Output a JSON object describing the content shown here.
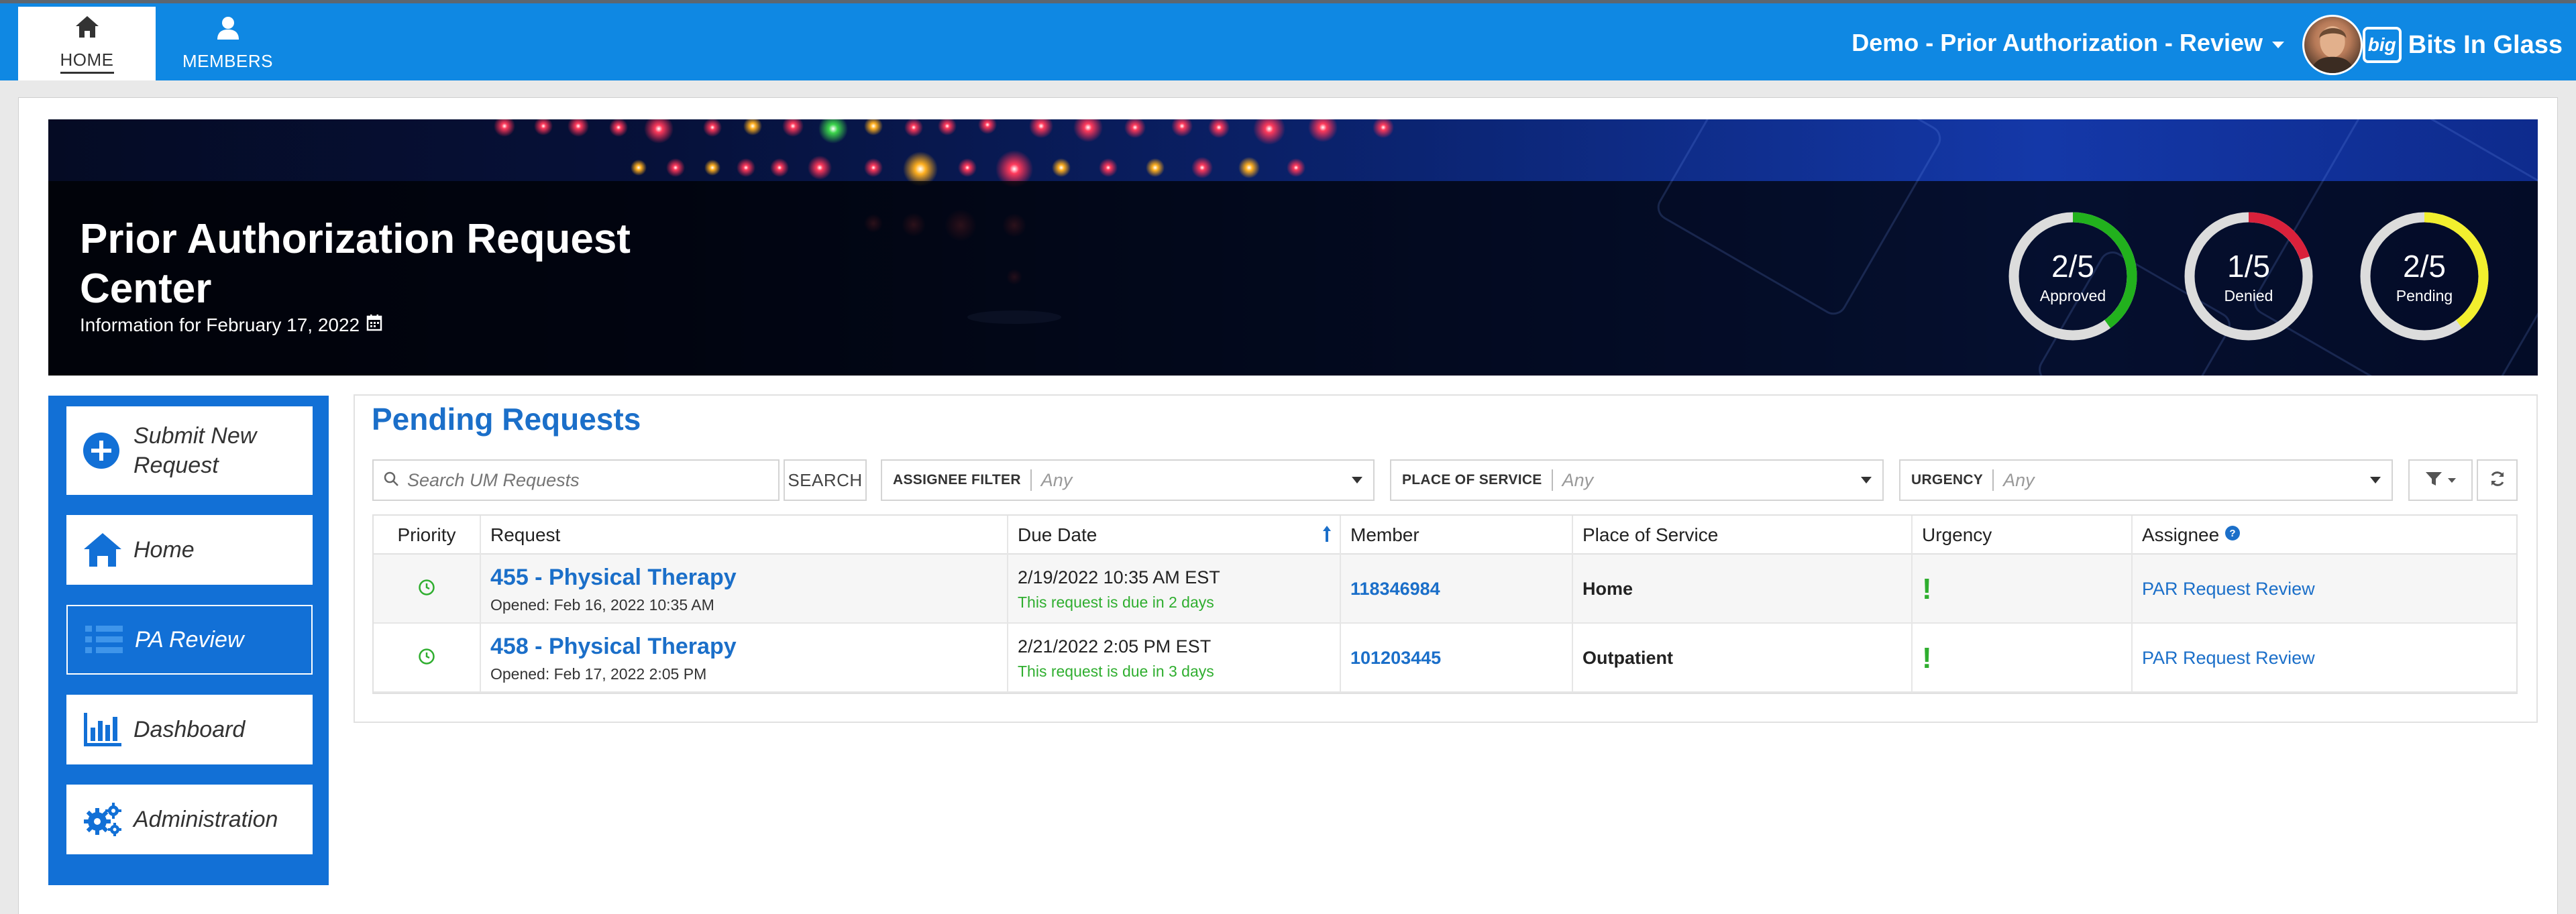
{
  "nav": {
    "tabs": [
      {
        "label": "HOME",
        "icon": "home-icon"
      },
      {
        "label": "MEMBERS",
        "icon": "user-icon"
      }
    ],
    "app_title": "Demo - Prior Authorization - Review",
    "brand_logo": "big",
    "brand_name": "Bits In Glass"
  },
  "hero": {
    "title": "Prior Authorization Request Center",
    "subtitle": "Information for February 17, 2022",
    "stats": [
      {
        "value": "2/5",
        "label": "Approved",
        "fraction": 0.4,
        "color": "#22b11d"
      },
      {
        "value": "1/5",
        "label": "Denied",
        "fraction": 0.2,
        "color": "#d9213b"
      },
      {
        "value": "2/5",
        "label": "Pending",
        "fraction": 0.4,
        "color": "#f2ef2e"
      }
    ]
  },
  "sidebar": {
    "items": [
      {
        "label": "Submit New Request",
        "icon": "plus-circle-icon"
      },
      {
        "label": "Home",
        "icon": "home-icon"
      },
      {
        "label": "PA Review",
        "icon": "list-icon"
      },
      {
        "label": "Dashboard",
        "icon": "bar-chart-icon"
      },
      {
        "label": "Administration",
        "icon": "gears-icon"
      }
    ]
  },
  "panel": {
    "title": "Pending Requests",
    "search_placeholder": "Search UM Requests",
    "search_button": "SEARCH",
    "filters": [
      {
        "label": "ASSIGNEE FILTER",
        "value": "Any"
      },
      {
        "label": "PLACE OF SERVICE",
        "value": "Any"
      },
      {
        "label": "URGENCY",
        "value": "Any"
      }
    ]
  },
  "table": {
    "columns": [
      "Priority",
      "Request",
      "Due Date",
      "Member",
      "Place of Service",
      "Urgency",
      "Assignee"
    ],
    "rows": [
      {
        "title": "455 - Physical Therapy",
        "opened": "Opened: Feb 16, 2022 10:35 AM",
        "due": "2/19/2022 10:35 AM EST",
        "due_note": "This request is due in 2 days",
        "member": "118346984",
        "place": "Home",
        "urgency": "!",
        "assignee": "PAR Request Review"
      },
      {
        "title": "458 - Physical Therapy",
        "opened": "Opened: Feb 17, 2022 2:05 PM",
        "due": "2/21/2022 2:05 PM EST",
        "due_note": "This request is due in 3 days",
        "member": "101203445",
        "place": "Outpatient",
        "urgency": "!",
        "assignee": "PAR Request Review"
      }
    ]
  }
}
